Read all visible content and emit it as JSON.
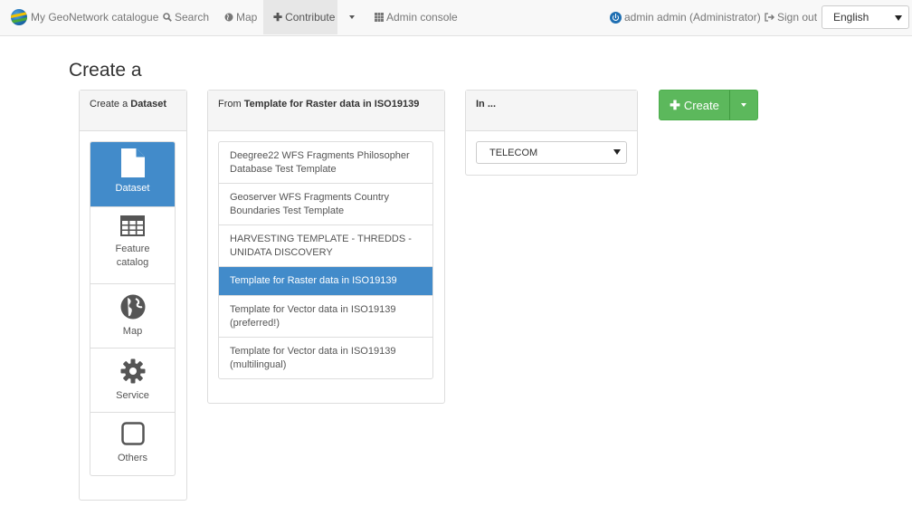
{
  "navbar": {
    "brand": "My GeoNetwork catalogue",
    "search": "Search",
    "map": "Map",
    "contribute": "Contribute",
    "admin_console": "Admin console",
    "user": "admin admin (Administrator)",
    "sign_out": "Sign out",
    "language": "English"
  },
  "page": {
    "title": "Create a"
  },
  "type_panel": {
    "heading_prefix": "Create a ",
    "heading_type": "Dataset",
    "items": [
      {
        "label": "Dataset",
        "icon": "file-icon",
        "active": true
      },
      {
        "label": "Feature catalog",
        "icon": "table-icon",
        "active": false
      },
      {
        "label": "Map",
        "icon": "globe-icon",
        "active": false
      },
      {
        "label": "Service",
        "icon": "cog-icon",
        "active": false
      },
      {
        "label": "Others",
        "icon": "square-icon",
        "active": false
      }
    ]
  },
  "template_panel": {
    "heading_prefix": "From ",
    "heading_template": "Template for Raster data in ISO19139",
    "items": [
      {
        "label": "Deegree22 WFS Fragments Philosopher Database Test Template",
        "active": false
      },
      {
        "label": "Geoserver WFS Fragments Country Boundaries Test Template",
        "active": false
      },
      {
        "label": "HARVESTING TEMPLATE - THREDDS - UNIDATA DISCOVERY",
        "active": false
      },
      {
        "label": "Template for Raster data in ISO19139",
        "active": true
      },
      {
        "label": "Template for Vector data in ISO19139 (preferred!)",
        "active": false
      },
      {
        "label": "Template for Vector data in ISO19139 (multilingual)",
        "active": false
      }
    ]
  },
  "group_panel": {
    "heading": "In ...",
    "selected_group": "TELECOM"
  },
  "actions": {
    "create_label": "Create"
  },
  "colors": {
    "primary": "#428bca",
    "success": "#5cb85c",
    "navbar_bg": "#f8f8f8"
  }
}
